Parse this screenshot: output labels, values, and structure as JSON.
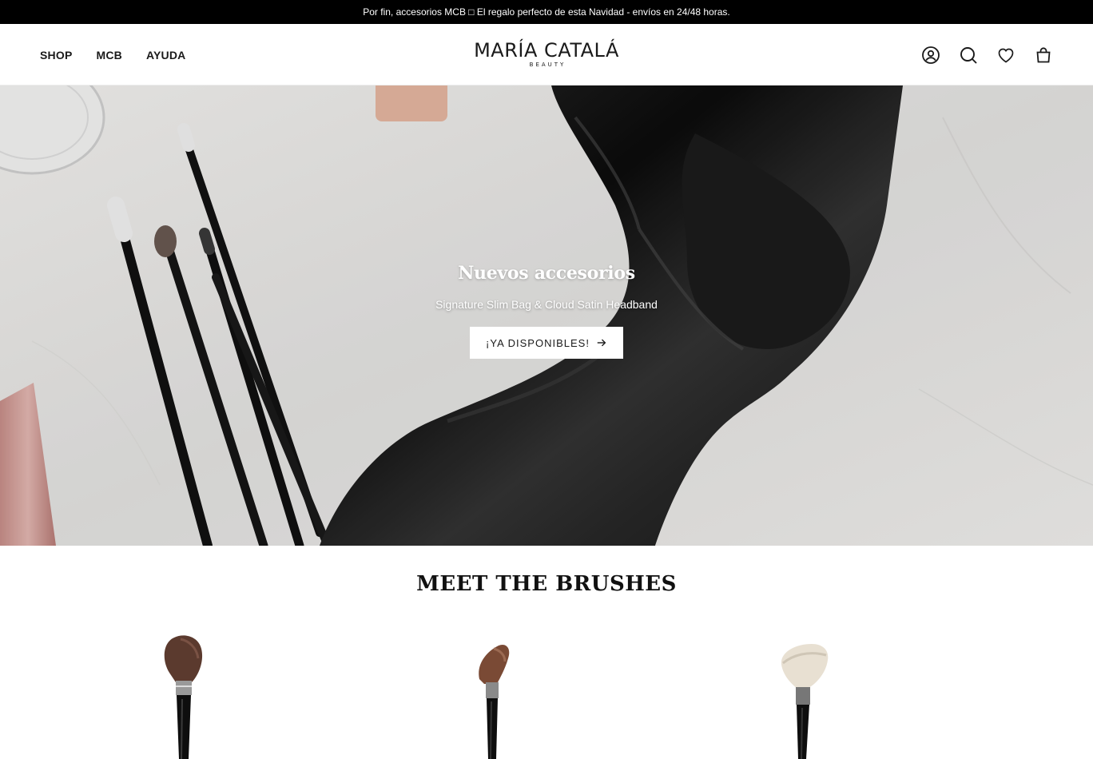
{
  "announcement": {
    "text": "Por fin, accesorios MCB □ El regalo perfecto de esta Navidad - envíos en 24/48 horas."
  },
  "nav": {
    "items": [
      "SHOP",
      "MCB",
      "AYUDA"
    ]
  },
  "logo": {
    "main": "MARÍA CATALÁ",
    "sub": "BEAUTY"
  },
  "header_icons": [
    "account-icon",
    "search-icon",
    "wishlist-heart-icon",
    "cart-bag-icon"
  ],
  "hero": {
    "title": "Nuevos accesorios",
    "subtitle": "Signature Slim Bag & Cloud Satin Headband",
    "button_label": "¡YA DISPONIBLES!",
    "button_icon": "arrow-right-icon"
  },
  "section": {
    "title": "MEET THE BRUSHES"
  },
  "colors": {
    "announcement_bg": "#000000",
    "text": "#1a1a1a",
    "button_bg": "#ffffff"
  }
}
